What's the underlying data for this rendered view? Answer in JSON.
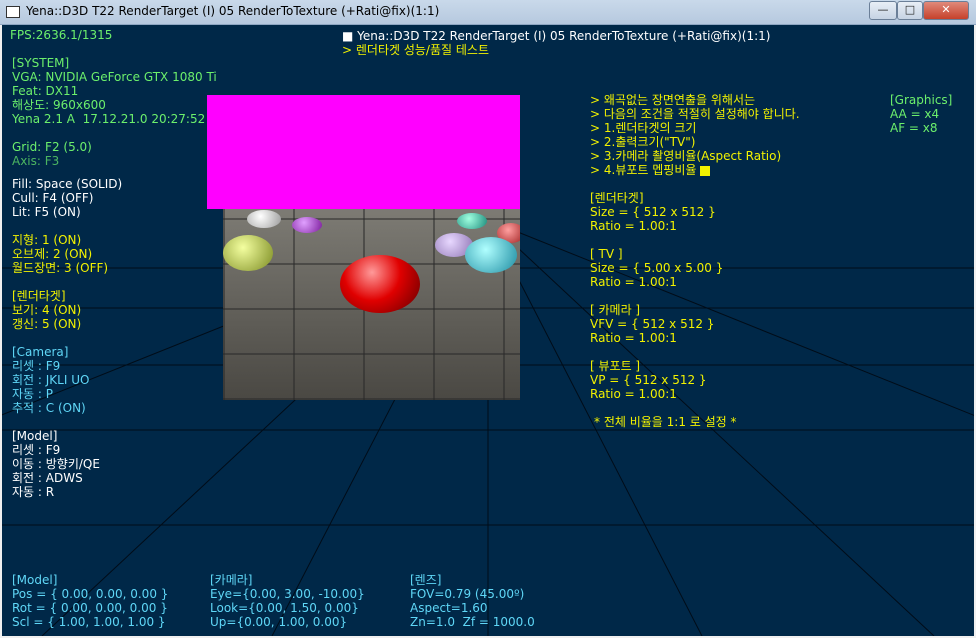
{
  "window": {
    "title": "Yena::D3D T22 RenderTarget (I) 05 RenderToTexture (+Rati@fix)(1:1)",
    "btn_minimize": "—",
    "btn_restore": "□",
    "btn_close": "✕"
  },
  "overlay": {
    "fps": "FPS:2636.1/1315",
    "heading1": "■ Yena::D3D T22 RenderTarget (I) 05 RenderToTexture (+Rati@fix)(1:1)",
    "heading2": "> 렌더타겟 성능/품질 테스트"
  },
  "system": {
    "section": "[SYSTEM]",
    "vga": "VGA: NVIDIA GeForce GTX 1080 Ti",
    "feat": "Feat: DX11",
    "resolution": "해상도: 960x600",
    "yena": "Yena 2.1 A  17.12.21.0 20:27:52",
    "grid": "Grid: F2 (5.0)",
    "axis": "Axis: F3"
  },
  "render": {
    "fill": "Fill: Space (SOLID)",
    "cull": "Cull: F4 (OFF)",
    "lit": "Lit: F5 (ON)",
    "terrain": "지형: 1 (ON)",
    "object": "오브제: 2 (ON)",
    "world": "월드장면: 3 (OFF)"
  },
  "rendertarget": {
    "section": "[렌더타겟]",
    "show": "보기: 4 (ON)",
    "update": "갱신: 5 (ON)"
  },
  "camera": {
    "section": "[Camera]",
    "reset": "리셋 : F9",
    "rotate": "회전 : JKLI UO",
    "auto": "자동 : P",
    "track": "추적 : C (ON)"
  },
  "model": {
    "section": "[Model]",
    "reset": "리셋 : F9",
    "move": "이동 : 방향키/QE",
    "rotate": "회전 : ADWS",
    "auto": "자동 : R"
  },
  "notes": {
    "l1": "> 왜곡없는 장면연출을 위해서는",
    "l2": "> 다음의 조건을 적절히 설정해야 합니다.",
    "l3": "> 1.렌더타겟의 크기",
    "l4": "> 2.출력크기(\"TV\")",
    "l5": "> 3.카메라 촬영비율(Aspect Ratio)",
    "l6": "> 4.뷰포트 멥핑비율"
  },
  "graphics": {
    "section": "[Graphics]",
    "aa": "AA = x4",
    "af": "AF = x8"
  },
  "rt_info": {
    "section": "[렌더타겟]",
    "size": "Size = { 512 x 512 }",
    "ratio": "Ratio = 1.00:1"
  },
  "tv_info": {
    "section": "[ TV ]",
    "size": "Size = { 5.00 x 5.00 }",
    "ratio": "Ratio = 1.00:1"
  },
  "cam_info": {
    "section": "[ 카메라 ]",
    "vfv": "VFV = { 512 x 512 }",
    "ratio": "Ratio = 1.00:1"
  },
  "vp_info": {
    "section": "[ 뷰포트 ]",
    "vp": "VP = { 512 x 512 }",
    "ratio": "Ratio = 1.00:1"
  },
  "ratio_note": "* 전체 비율을 1:1 로 설정 *",
  "bottom": {
    "model_section": "[Model]",
    "pos": "Pos = { 0.00, 0.00, 0.00 }",
    "rot": "Rot = { 0.00, 0.00, 0.00 }",
    "scl": "Scl = { 1.00, 1.00, 1.00 }",
    "cam_section": "[카메라]",
    "eye": "Eye={0.00, 3.00, -10.00}",
    "look": "Look={0.00, 1.50, 0.00}",
    "up": "Up={0.00, 1.00, 0.00}",
    "lens_section": "[렌즈]",
    "fov": "FOV=0.79 (45.00º)",
    "aspect": "Aspect=1.60",
    "zn": "Zn=1.0  Zf = 1000.0"
  },
  "colors": {
    "overlay_green": "#6cf06c",
    "overlay_yellow": "#f2f200",
    "overlay_cyan": "#5fd7f7",
    "viewport_bg": "#002848",
    "magenta": "#ff00ff"
  }
}
